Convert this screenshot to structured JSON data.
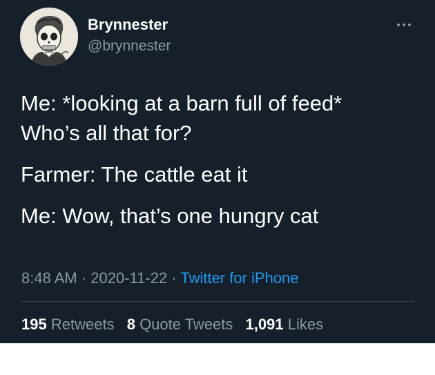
{
  "user": {
    "display_name": "Brynnester",
    "handle": "@brynnester",
    "avatar_icon": "skull-portrait-avatar"
  },
  "more_icon": "ellipsis-icon",
  "tweet": {
    "paragraphs": [
      "Me: *looking at a barn full of feed*\nWho’s all that for?",
      "Farmer: The cattle eat it",
      "Me: Wow, that’s one hungry cat"
    ]
  },
  "meta": {
    "time": "8:48 AM",
    "separator": " · ",
    "date": "2020-11-22",
    "source": "Twitter for iPhone"
  },
  "stats": {
    "retweets_count": "195",
    "retweets_label": "Retweets",
    "quotes_count": "8",
    "quotes_label": "Quote Tweets",
    "likes_count": "1,091",
    "likes_label": "Likes"
  },
  "colors": {
    "background": "#15202b",
    "secondary_text": "#8b98a5",
    "link": "#1d9bf0",
    "divider": "#38444d"
  }
}
